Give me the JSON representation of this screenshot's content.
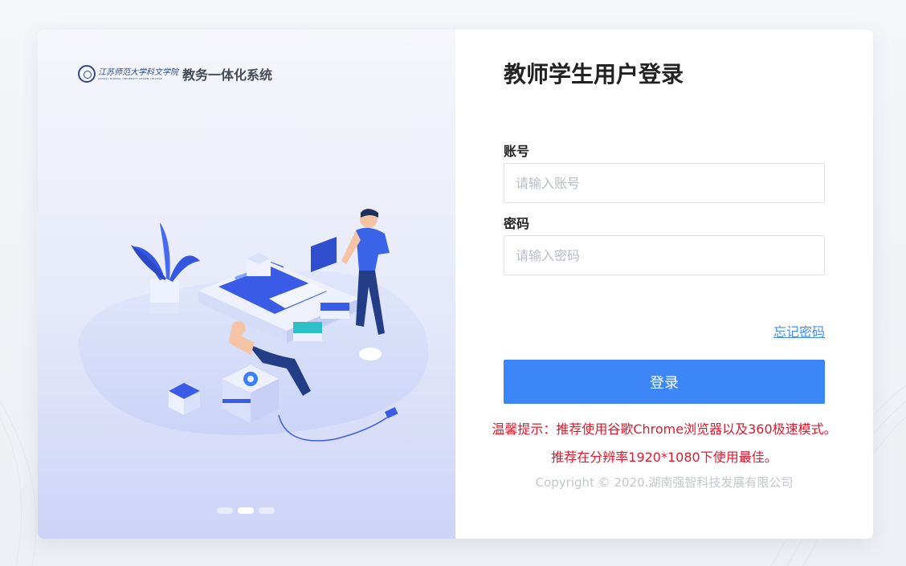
{
  "brand": {
    "school_name_cn": "江苏师范大学科文学院",
    "school_name_en": "JIANGSU NORMAL UNIVERSITY KEWEN COLLEGE",
    "system_name": "教务一体化系统"
  },
  "carousel": {
    "slide_count": 3,
    "active_index": 1
  },
  "login": {
    "title": "教师学生用户登录",
    "account_label": "账号",
    "account_placeholder": "请输入账号",
    "account_value": "",
    "password_label": "密码",
    "password_placeholder": "请输入密码",
    "password_value": "",
    "forgot_label": "忘记密码",
    "submit_label": "登录"
  },
  "tips": {
    "line1": "温馨提示：推荐使用谷歌Chrome浏览器以及360极速模式。",
    "line2": "推荐在分辨率1920*1080下使用最佳。"
  },
  "footer": {
    "copyright": "Copyright © 2020.湖南强智科技发展有限公司"
  },
  "colors": {
    "accent": "#3d86f7",
    "link": "#3f8ef5",
    "warning": "#e5162b",
    "muted": "#c3c6cc"
  },
  "icons": {
    "school_logo": "school-seal-logo",
    "illustration": "isometric-workstation-illustration"
  }
}
